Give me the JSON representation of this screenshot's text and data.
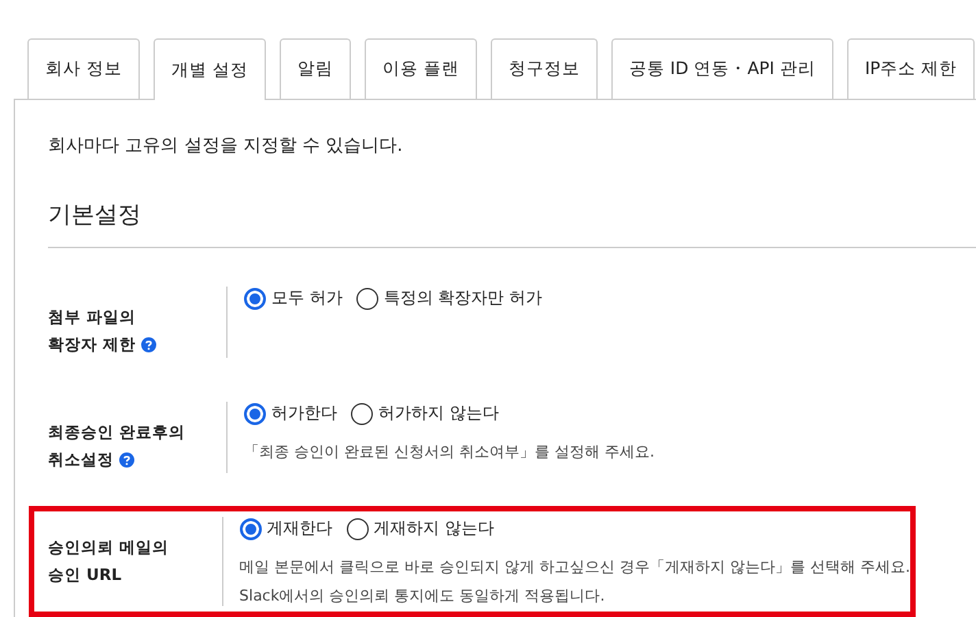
{
  "tabs": [
    {
      "label": "회사 정보",
      "selected": false
    },
    {
      "label": "개별 설정",
      "selected": true
    },
    {
      "label": "알림",
      "selected": false
    },
    {
      "label": "이용 플랜",
      "selected": false
    },
    {
      "label": "청구정보",
      "selected": false
    },
    {
      "label": "공통 ID 연동・API 관리",
      "selected": false
    },
    {
      "label": "IP주소 제한",
      "selected": false
    }
  ],
  "description": "회사마다 고유의 설정을 지정할 수 있습니다.",
  "section_title": "기본설정",
  "settings": [
    {
      "label_lines": [
        "첨부 파일의",
        "확장자 제한"
      ],
      "help": true,
      "highlighted": false,
      "options": [
        {
          "label": "모두 허가",
          "selected": true
        },
        {
          "label": "특정의 확장자만 허가",
          "selected": false
        }
      ]
    },
    {
      "label_lines": [
        "최종승인 완료후의",
        "취소설정"
      ],
      "help": true,
      "highlighted": false,
      "options": [
        {
          "label": "허가한다",
          "selected": true
        },
        {
          "label": "허가하지 않는다",
          "selected": false
        }
      ],
      "notes": [
        "「최종 승인이 완료된 신청서의 취소여부」를 설정해 주세요."
      ]
    },
    {
      "label_lines": [
        "승인의뢰 메일의",
        "승인 URL"
      ],
      "help": false,
      "highlighted": true,
      "options": [
        {
          "label": "게재한다",
          "selected": true
        },
        {
          "label": "게재하지 않는다",
          "selected": false
        }
      ],
      "notes": [
        "메일 본문에서 클릭으로 바로 승인되지 않게 하고싶으신 경우「게재하지 않는다」를 선택해 주세요.",
        "Slack에서의 승인의뢰 통지에도 동일하게 적용됩니다."
      ]
    }
  ]
}
